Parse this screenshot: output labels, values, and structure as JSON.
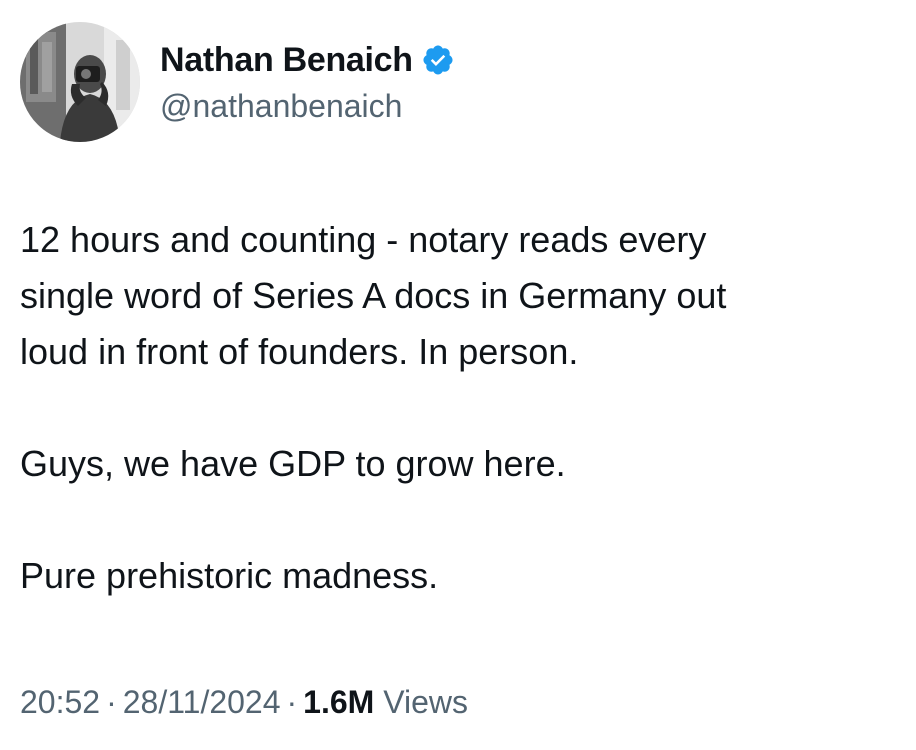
{
  "author": {
    "display_name": "Nathan Benaich",
    "handle": "@nathanbenaich",
    "verified": true,
    "verified_color": "#1d9bf0",
    "avatar_icon": "profile-photo-person-with-camera"
  },
  "tweet": {
    "paragraphs": [
      "12 hours and counting - notary reads every\nsingle word of Series A docs in Germany out\nloud in front of founders. In person.",
      "Guys, we have GDP to grow here.",
      "Pure prehistoric madness."
    ]
  },
  "meta": {
    "time": "20:52",
    "date": "28/11/2024",
    "separator": "·",
    "views_count": "1.6M",
    "views_label": "Views"
  },
  "colors": {
    "text_primary": "#0f1419",
    "text_secondary": "#536471",
    "background": "#ffffff"
  }
}
